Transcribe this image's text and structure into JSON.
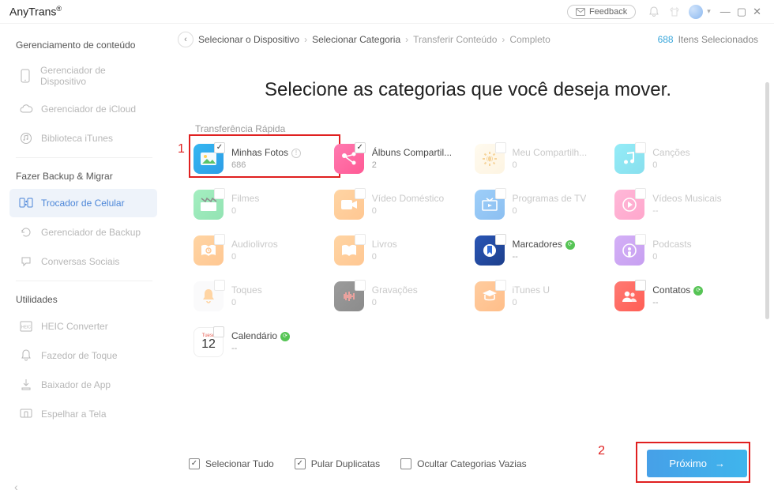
{
  "app": {
    "name": "AnyTrans",
    "reg": "®"
  },
  "titlebar": {
    "feedback": "Feedback"
  },
  "sidebar": {
    "section_management": "Gerenciamento de conteúdo",
    "device_manager": "Gerenciador de Dispositivo",
    "icloud_manager": "Gerenciador de iCloud",
    "itunes_library": "Biblioteca iTunes",
    "section_backup": "Fazer Backup & Migrar",
    "phone_switcher": "Trocador de Celular",
    "backup_manager": "Gerenciador de Backup",
    "social_convos": "Conversas Sociais",
    "section_utilities": "Utilidades",
    "heic": "HEIC Converter",
    "ringtone": "Fazedor de Toque",
    "app_downloader": "Baixador de App",
    "mirror": "Espelhar a Tela"
  },
  "breadcrumbs": {
    "b1": "Selecionar o Dispositivo",
    "b2": "Selecionar Categoria",
    "b3": "Transferir Conteúdo",
    "b4": "Completo",
    "selected_count": "688",
    "selected_label": "Itens Selecionados"
  },
  "page": {
    "title": "Selecione as categorias que você deseja mover.",
    "group_quick": "Transferência Rápida"
  },
  "steps": {
    "one": "1",
    "two": "2"
  },
  "calendar_tile": {
    "dow": "Tuesd",
    "dom": "12"
  },
  "categories": [
    {
      "key": "my_photos",
      "label": "Minhas Fotos",
      "count": "686",
      "checked": true,
      "info": true,
      "theme": "bg-photos"
    },
    {
      "key": "shared_albums",
      "label": "Álbuns Compartil...",
      "count": "2",
      "checked": true,
      "theme": "bg-share"
    },
    {
      "key": "my_sharing",
      "label": "Meu Compartilh...",
      "count": "0",
      "faded": true,
      "theme": "bg-flower"
    },
    {
      "key": "songs",
      "label": "Canções",
      "count": "0",
      "faded": true,
      "theme": "bg-cyan"
    },
    {
      "key": "movies",
      "label": "Filmes",
      "count": "0",
      "faded": true,
      "theme": "bg-green"
    },
    {
      "key": "home_video",
      "label": "Vídeo Doméstico",
      "count": "0",
      "faded": true,
      "theme": "bg-orange"
    },
    {
      "key": "tv_shows",
      "label": "Programas de TV",
      "count": "0",
      "faded": true,
      "theme": "bg-blue"
    },
    {
      "key": "music_videos",
      "label": "Vídeos Musicais",
      "count": "--",
      "faded": true,
      "theme": "bg-pink"
    },
    {
      "key": "audiobooks",
      "label": "Audiolivros",
      "count": "0",
      "faded": true,
      "theme": "bg-orange"
    },
    {
      "key": "books",
      "label": "Livros",
      "count": "0",
      "faded": true,
      "theme": "bg-orange"
    },
    {
      "key": "bookmarks",
      "label": "Marcadores",
      "count": "--",
      "green": true,
      "theme": "bg-navy"
    },
    {
      "key": "podcasts",
      "label": "Podcasts",
      "count": "0",
      "faded": true,
      "theme": "bg-purple"
    },
    {
      "key": "ringtones",
      "label": "Toques",
      "count": "0",
      "faded": true,
      "theme": "bg-white"
    },
    {
      "key": "recordings",
      "label": "Gravações",
      "count": "0",
      "faded": true,
      "theme": "bg-dark"
    },
    {
      "key": "itunes_u",
      "label": "iTunes U",
      "count": "0",
      "faded": true,
      "theme": "bg-oranged"
    },
    {
      "key": "contacts",
      "label": "Contatos",
      "count": "--",
      "green": true,
      "theme": "bg-red"
    },
    {
      "key": "calendar",
      "label": "Calendário",
      "count": "--",
      "green": true,
      "calendar": true
    }
  ],
  "footer": {
    "select_all": "Selecionar Tudo",
    "skip_dupes": "Pular Duplicatas",
    "hide_empty": "Ocultar Categorias Vazias",
    "next": "Próximo"
  }
}
